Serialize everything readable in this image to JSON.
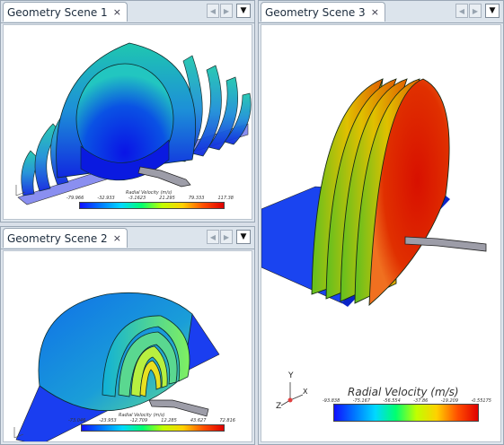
{
  "tabs": {
    "scene1": {
      "label": "Geometry Scene 1",
      "close": "×"
    },
    "scene2": {
      "label": "Geometry Scene 2",
      "close": "×"
    },
    "scene3": {
      "label": "Geometry Scene 3",
      "close": "×"
    }
  },
  "controls": {
    "prev": "◀",
    "next": "▶",
    "menu": "▼"
  },
  "scene1": {
    "legend_title": "Radial Velocity (m/s)",
    "legend_labels": [
      "-79.966",
      "-32.933",
      "-3.1623",
      "21.295",
      "79.333",
      "117.38"
    ]
  },
  "scene2": {
    "legend_title": "Radial Velocity (m/s)",
    "legend_labels": [
      "-73.046",
      "-23.953",
      "-12.709",
      "12.285",
      "43.627",
      "72.816"
    ]
  },
  "scene3": {
    "legend_title": "Radial Velocity (m/s)",
    "legend_labels": [
      "-93.838",
      "-75.167",
      "-56.554",
      "-37.86",
      "-19.209",
      "-0.55175"
    ],
    "axis": {
      "x": "X",
      "y": "Y",
      "z": "Z"
    }
  },
  "colors": {
    "accent": "#2266cc",
    "background": "#dfe6ee"
  }
}
